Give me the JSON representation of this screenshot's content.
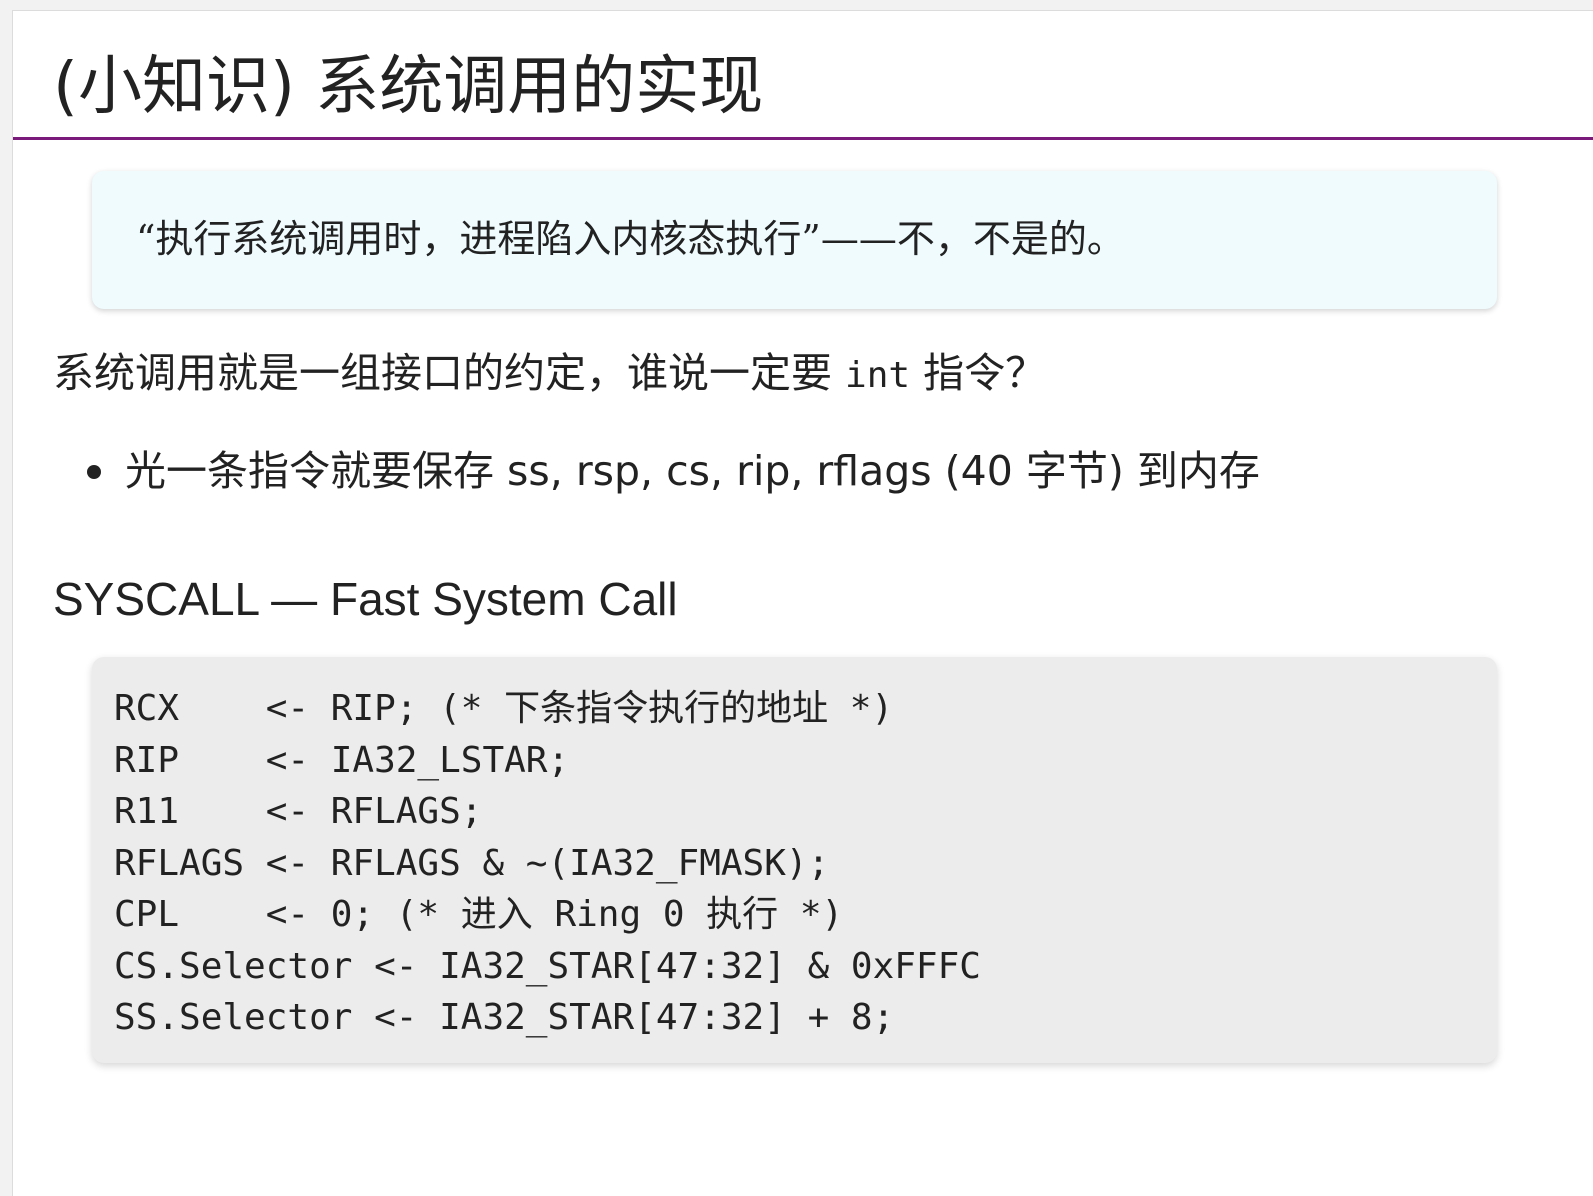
{
  "slide": {
    "title": "(小知识) 系统调用的实现",
    "quote": "“执行系统调用时，进程陷入内核态执行”——不，不是的。",
    "paragraph": {
      "before": "系统调用就是一组接口的约定，谁说一定要 ",
      "code": "int",
      "after": " 指令？"
    },
    "bullets": [
      "光一条指令就要保存 ss, rsp, cs, rip, rflags (40 字节) 到内存"
    ],
    "subheading": "SYSCALL — Fast System Call",
    "code_lines": [
      "RCX    <- RIP; (* 下条指令执行的地址 *)",
      "RIP    <- IA32_LSTAR;",
      "R11    <- RFLAGS;",
      "RFLAGS <- RFLAGS & ~(IA32_FMASK);",
      "CPL    <- 0; (* 进入 Ring 0 执行 *)",
      "CS.Selector <- IA32_STAR[47:32] & 0xFFFC",
      "SS.Selector <- IA32_STAR[47:32] + 8;"
    ]
  },
  "colors": {
    "title_rule": "#7a1a7a",
    "quote_background": "#effbfd",
    "code_background": "#ececec",
    "text": "#222222"
  }
}
